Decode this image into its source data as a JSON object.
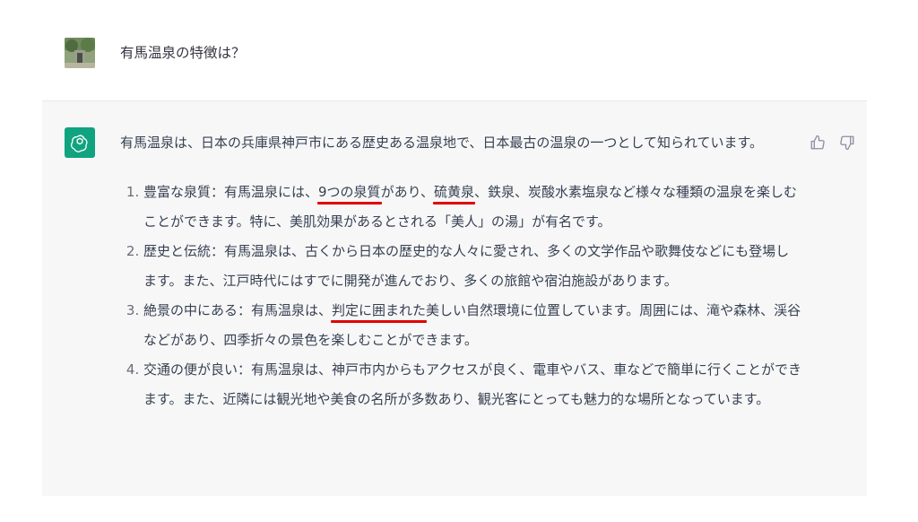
{
  "user_message": {
    "text": "有馬温泉の特徴は？",
    "avatar_icon": "user-photo-avatar"
  },
  "assistant_message": {
    "logo_icon": "openai-logo-icon",
    "intro": "有馬温泉は、日本の兵庫県神戸市にある歴史ある温泉地で、日本最古の温泉の一つとして知られています。",
    "items": [
      {
        "parts": [
          {
            "text": "豊富な泉質：有馬温泉には、",
            "hl": false
          },
          {
            "text": "9つの泉質",
            "hl": true
          },
          {
            "text": "があり、",
            "hl": false
          },
          {
            "text": "硫黄泉",
            "hl": true
          },
          {
            "text": "、鉄泉、炭酸水素塩泉など様々な種類の温泉を楽しむことができます。特に、美肌効果があるとされる「美人」の湯」が有名です。",
            "hl": false
          }
        ]
      },
      {
        "parts": [
          {
            "text": "歴史と伝統：有馬温泉は、古くから日本の歴史的な人々に愛され、多くの文学作品や歌舞伎などにも登場します。また、江戸時代にはすでに開発が進んでおり、多くの旅館や宿泊施設があります。",
            "hl": false
          }
        ]
      },
      {
        "parts": [
          {
            "text": "絶景の中にある：有馬温泉は、",
            "hl": false
          },
          {
            "text": "判定に囲まれた",
            "hl": true
          },
          {
            "text": "美しい自然環境に位置しています。周囲には、滝や森林、渓谷などがあり、四季折々の景色を楽しむことができます。",
            "hl": false
          }
        ]
      },
      {
        "parts": [
          {
            "text": "交通の便が良い：有馬温泉は、神戸市内からもアクセスが良く、電車やバス、車などで簡単に行くことができます。また、近隣には観光地や美食の名所が多数あり、観光客にとっても魅力的な場所となっています。",
            "hl": false
          }
        ]
      }
    ],
    "highlight_color": "#e00000"
  },
  "feedback": {
    "thumbs_up_icon": "thumbs-up-icon",
    "thumbs_down_icon": "thumbs-down-icon"
  },
  "colors": {
    "assistant_bg": "#f7f7f8",
    "logo_bg": "#10a37f"
  }
}
